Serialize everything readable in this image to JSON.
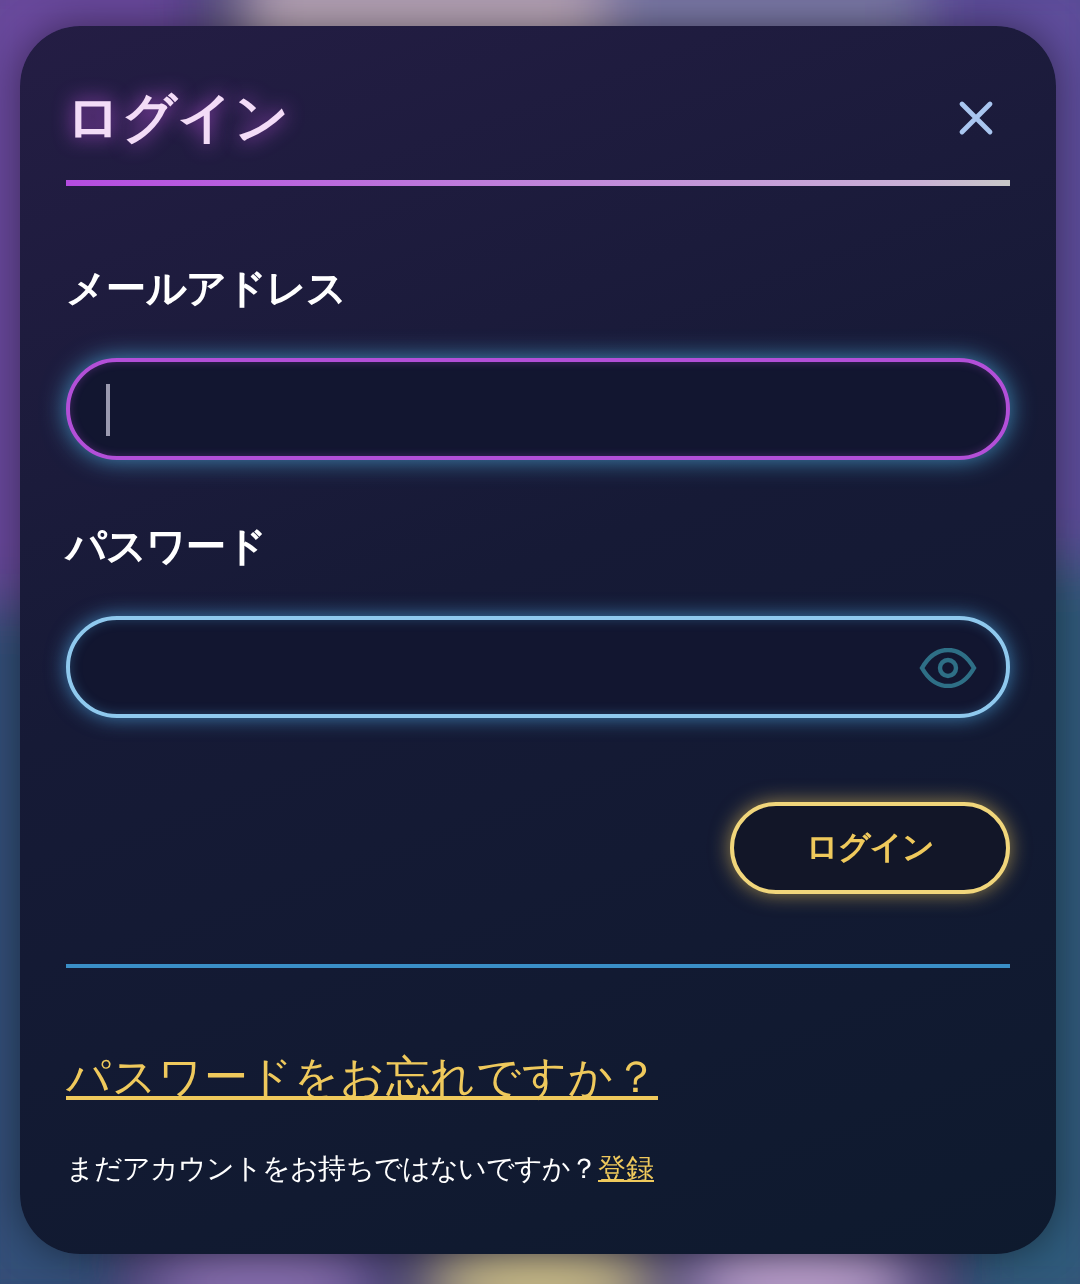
{
  "dialog": {
    "title": "ログイン",
    "fields": [
      {
        "kind": "email",
        "label": "メールアドレス",
        "focused": true
      },
      {
        "kind": "password",
        "label": "パスワード",
        "focused": false
      }
    ],
    "submit": "ログイン",
    "forgot_link": "パスワードをお忘れですか？",
    "signup_prompt": "まだアカウントをお持ちではないですか？",
    "signup_link": "登録"
  }
}
